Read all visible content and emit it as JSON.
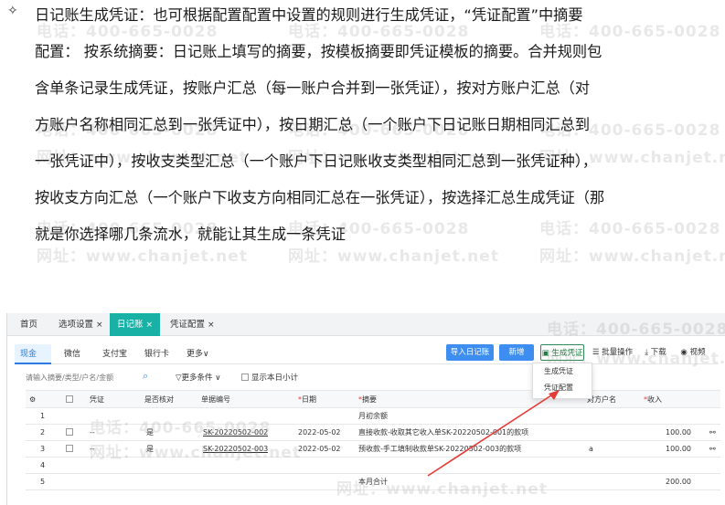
{
  "paragraph": {
    "bullet": "✧",
    "lines": [
      "日记账生成凭证：也可根据配置配置中设置的规则进行生成凭证，“凭证配置”中摘要",
      "配置：  按系统摘要：日记账上填写的摘要，按模板摘要即凭证模板的摘要。合并规则包",
      "含单条记录生成凭证，按账户汇总（每一账户合并到一张凭证），按对方账户汇总（对",
      "方账户名称相同汇总到一张凭证中），按日期汇总（一个账户下日记账日期相同汇总到",
      "一张凭证中），按收支类型汇总（一个账户下日记账收支类型相同汇总到一张凭证种），",
      "按收支方向汇总（一个账户下收支方向相同汇总在一张凭证），按选择汇总生成凭证（那",
      "就是你选择哪几条流水，就能让其生成一条凭证"
    ]
  },
  "watermark": {
    "phone": "电话：400-665-0028",
    "site": "网址：www.chanjet.net"
  },
  "app": {
    "tabs": [
      {
        "label": "首页",
        "closable": false
      },
      {
        "label": "选项设置",
        "closable": true
      },
      {
        "label": "日记账",
        "closable": true,
        "active": true
      },
      {
        "label": "凭证配置",
        "closable": true
      }
    ],
    "close_glyph": "×",
    "subtabs": [
      "现金",
      "微信",
      "支付宝",
      "银行卡",
      "更多∨"
    ],
    "buttons": {
      "import": "导入日记账",
      "sync": "新增",
      "gen_voucher": "生成凭证",
      "batch": "批量操作",
      "download": "下载",
      "view": "视频"
    },
    "search_placeholder": "请输入摘要/类型/户名/金额",
    "more_conditions": "更多条件 ∨",
    "show_subtotal": "显示本日小计",
    "dropdown": [
      "生成凭证",
      "凭证配置"
    ],
    "columns": [
      "",
      "",
      "凭证",
      "是否核对",
      "单据编号",
      "日期",
      "摘要",
      "对方户名",
      "收入",
      ""
    ],
    "required_cols": [
      5,
      6,
      8
    ],
    "rows": [
      {
        "no": "1",
        "voucher": "",
        "checked": "",
        "doc": "",
        "date": "",
        "summary": "月初余额",
        "party": "",
        "income": ""
      },
      {
        "no": "2",
        "voucher": "--",
        "checked": "是",
        "doc": "SK-20220502-002",
        "date": "2022-05-02",
        "summary": "直接收款-收取其它收入单SK-20220502-001的款项",
        "party": "",
        "income": "100.00"
      },
      {
        "no": "3",
        "voucher": "--",
        "checked": "是",
        "doc": "SK-20220502-003",
        "date": "2022-05-02",
        "summary": "预收款-手工填制收款单SK-20220502-003的款项",
        "party": "a",
        "income": "100.00"
      },
      {
        "no": "4",
        "voucher": "",
        "checked": "",
        "doc": "",
        "date": "",
        "summary": "",
        "party": "",
        "income": ""
      },
      {
        "no": "5",
        "voucher": "",
        "checked": "",
        "doc": "",
        "date": "",
        "summary": "本月合计",
        "party": "",
        "income": "200.00"
      }
    ]
  },
  "colors": {
    "accent_teal": "#19b0a6",
    "primary_blue": "#3d8ef0",
    "required_red": "#e53935",
    "arrow_red": "#e53935"
  }
}
